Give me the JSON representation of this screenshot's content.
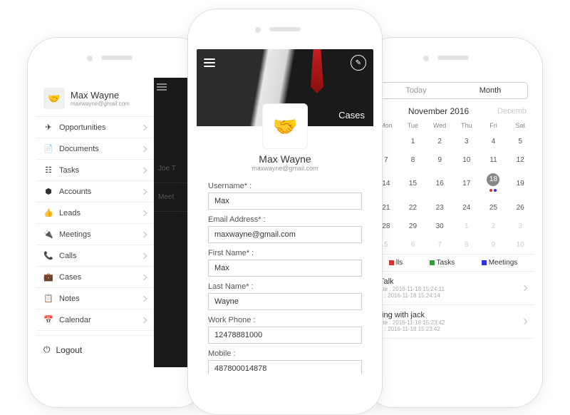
{
  "left": {
    "profile": {
      "name": "Max Wayne",
      "email": "maxwayne@gmail.com"
    },
    "menu": [
      {
        "label": "Opportunities",
        "icon": "✈"
      },
      {
        "label": "Documents",
        "icon": "📄"
      },
      {
        "label": "Tasks",
        "icon": "☷"
      },
      {
        "label": "Accounts",
        "icon": "⬢"
      },
      {
        "label": "Leads",
        "icon": "👍"
      },
      {
        "label": "Meetings",
        "icon": "🔌"
      },
      {
        "label": "Calls",
        "icon": "📞"
      },
      {
        "label": "Cases",
        "icon": "💼"
      },
      {
        "label": "Notes",
        "icon": "📋"
      },
      {
        "label": "Calendar",
        "icon": "📅"
      }
    ],
    "logout": "Logout",
    "background": {
      "item1": {
        "title": "Joe T",
        "sub": ""
      },
      "item2": {
        "title": "Meet",
        "sub": ""
      }
    }
  },
  "center": {
    "hero_title": "Cases",
    "name": "Max Wayne",
    "email": "maxwayne@gmail.com",
    "fields": {
      "username": {
        "label": "Username* :",
        "value": "Max"
      },
      "emailaddr": {
        "label": "Email Address* :",
        "value": "maxwayne@gmail.com"
      },
      "firstname": {
        "label": "First Name* :",
        "value": "Max"
      },
      "lastname": {
        "label": "Last Name* :",
        "value": "Wayne"
      },
      "workphone": {
        "label": "Work Phone :",
        "value": "12478881000"
      },
      "mobile": {
        "label": "Mobile :",
        "value": "487800014878"
      }
    }
  },
  "right": {
    "seg": {
      "today": "Today",
      "month": "Month"
    },
    "month_title": "November 2016",
    "next_month": "Decemb",
    "weekdays": [
      "Mon",
      "Tue",
      "Wed",
      "Thu",
      "Fri",
      "Sat"
    ],
    "weeks": [
      [
        "",
        "1",
        "2",
        "3",
        "4",
        "5"
      ],
      [
        "7",
        "8",
        "9",
        "10",
        "11",
        "12"
      ],
      [
        "14",
        "15",
        "16",
        "17",
        "18",
        "19"
      ],
      [
        "21",
        "22",
        "23",
        "24",
        "25",
        "26"
      ],
      [
        "28",
        "29",
        "30",
        "1",
        "2",
        "3"
      ],
      [
        "5",
        "6",
        "7",
        "8",
        "9",
        "10"
      ]
    ],
    "today_cell": "18",
    "legend": {
      "calls": "lls",
      "tasks": "Tasks",
      "meetings": "Meetings"
    },
    "events": [
      {
        "title": "Talk",
        "line1": "ate :  2016-11-18 15:24:11",
        "line2": "e  :  2016-11-18 15:24:14"
      },
      {
        "title": "ting with jack",
        "line1": "ate :  2016-11-18 15:23:42",
        "line2": "e  :  2016-11-18 15:23:42"
      }
    ]
  }
}
